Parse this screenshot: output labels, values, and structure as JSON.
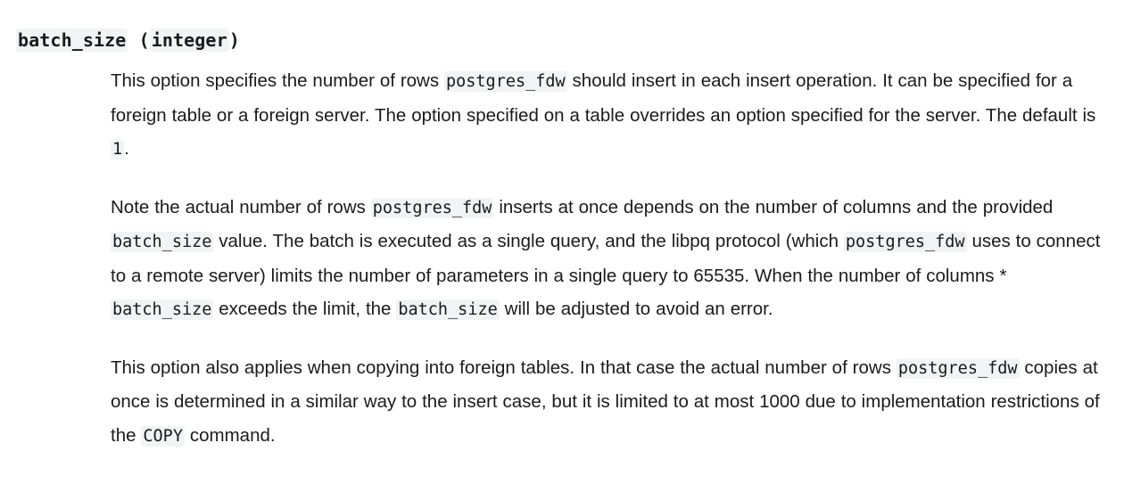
{
  "heading": {
    "term": "batch_size",
    "open_paren": " (",
    "type": "integer",
    "close_paren": ")"
  },
  "colors": {
    "annotation_underline": "#ff0000",
    "code_background": "#f2f3f5",
    "text": "#1b1b1b",
    "page_background": "#ffffff"
  },
  "paragraphs": [
    {
      "id": "paragraph-1",
      "segments": [
        {
          "type": "text",
          "value": "This option specifies the number of rows "
        },
        {
          "type": "code",
          "value": "postgres_fdw"
        },
        {
          "type": "text",
          "value": " should insert in each "
        },
        {
          "type": "underlined",
          "value": "insert operation."
        },
        {
          "type": "text",
          "value": " It can be specified for a foreign table or a foreign server. The option specified on a table overrides an option specified for the server. The default is "
        },
        {
          "type": "code",
          "value": "1"
        },
        {
          "type": "text",
          "value": "."
        }
      ],
      "plain_text": "This option specifies the number of rows postgres_fdw should insert in each insert operation. It can be specified for a foreign table or a foreign server. The option specified on a table overrides an option specified for the server. The default is 1."
    },
    {
      "id": "paragraph-2",
      "segments": [
        {
          "type": "text",
          "value": "Note the actual number of rows "
        },
        {
          "type": "code",
          "value": "postgres_fdw"
        },
        {
          "type": "text",
          "value": " inserts at once depends on the number of columns and the provided "
        },
        {
          "type": "code",
          "value": "batch_size"
        },
        {
          "type": "text",
          "value": " value. The batch is executed as a single query, and the libpq protocol (which "
        },
        {
          "type": "code",
          "value": "postgres_fdw"
        },
        {
          "type": "text",
          "value": " uses to connect to a remote server) "
        },
        {
          "type": "underlined",
          "value": "limits the number of parameters in a single query to 65535."
        },
        {
          "type": "text",
          "value": " When the number of columns * "
        },
        {
          "type": "code",
          "value": "batch_size"
        },
        {
          "type": "text",
          "value": " exceeds the limit, the "
        },
        {
          "type": "code",
          "value": "batch_size"
        },
        {
          "type": "text",
          "value": " will be adjusted to avoid an error."
        }
      ],
      "plain_text": "Note the actual number of rows postgres_fdw inserts at once depends on the number of columns and the provided batch_size value. The batch is executed as a single query, and the libpq protocol (which postgres_fdw uses to connect to a remote server) limits the number of parameters in a single query to 65535. When the number of columns * batch_size exceeds the limit, the batch_size will be adjusted to avoid an error."
    },
    {
      "id": "paragraph-3",
      "segments": [
        {
          "type": "text",
          "value": "This option also applies when copying into foreign tables. In that case the actual number of rows "
        },
        {
          "type": "code",
          "value": "postgres_fdw"
        },
        {
          "type": "text",
          "value": " copies at once is determined in a similar way to the insert case, but it is limited to at most 1000 due to implementation restrictions of the "
        },
        {
          "type": "code",
          "value": "COPY"
        },
        {
          "type": "text",
          "value": " command."
        }
      ],
      "plain_text": "This option also applies when copying into foreign tables. In that case the actual number of rows postgres_fdw copies at once is determined in a similar way to the insert case, but it is limited to at most 1000 due to implementation restrictions of the COPY command."
    }
  ],
  "annotations": [
    {
      "id": "annotation-1",
      "text": "insert operation.",
      "paragraph": "paragraph-1"
    },
    {
      "id": "annotation-2",
      "text": "limits the number of parameters in a single query to 65535.",
      "paragraph": "paragraph-2"
    }
  ]
}
